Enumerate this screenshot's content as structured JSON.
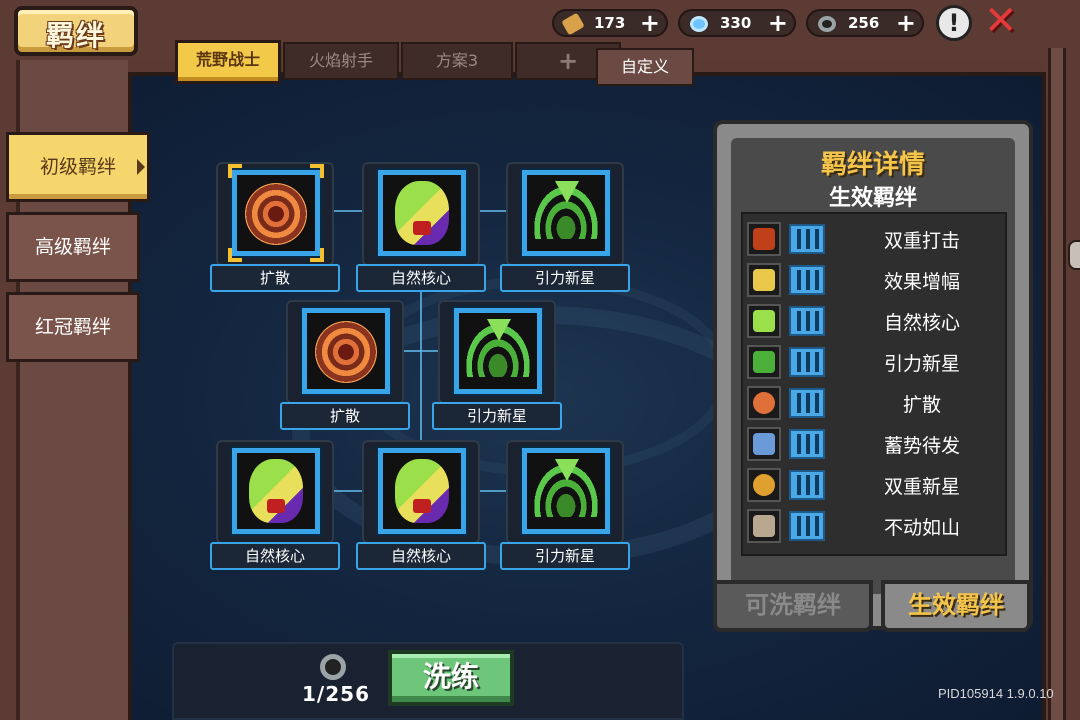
{
  "header": {
    "title": "羁绊",
    "currencies": [
      {
        "name": "gold",
        "amount": "173",
        "icon": "horn-icon"
      },
      {
        "name": "gem",
        "amount": "330",
        "icon": "gem-icon"
      },
      {
        "name": "stone",
        "amount": "256",
        "icon": "gear-stone-icon"
      }
    ],
    "plus": "+",
    "alert": "!",
    "close": "✕"
  },
  "plan_tabs": [
    {
      "label": "荒野战士",
      "active": true
    },
    {
      "label": "火焰射手",
      "active": false
    },
    {
      "label": "方案3",
      "active": false
    },
    {
      "label": "+",
      "active": false
    },
    {
      "label": "自定义",
      "active": false
    }
  ],
  "side_tabs": [
    {
      "label": "初级羁绊",
      "active": true
    },
    {
      "label": "高级羁绊",
      "active": false
    },
    {
      "label": "红冠羁绊",
      "active": false
    }
  ],
  "grid": [
    {
      "label": "扩散",
      "icon": "ring-icon",
      "selected": true
    },
    {
      "label": "自然核心",
      "icon": "nature-core-icon",
      "selected": false
    },
    {
      "label": "引力新星",
      "icon": "gravity-star-icon",
      "selected": false
    },
    {
      "label": "扩散",
      "icon": "ring-icon",
      "selected": false
    },
    {
      "label": "引力新星",
      "icon": "gravity-star-icon",
      "selected": false
    },
    {
      "label": "自然核心",
      "icon": "nature-core-icon",
      "selected": false
    },
    {
      "label": "自然核心",
      "icon": "nature-core-icon",
      "selected": false
    },
    {
      "label": "引力新星",
      "icon": "gravity-star-icon",
      "selected": false
    }
  ],
  "panel": {
    "title": "羁绊详情",
    "subtitle": "生效羁绊",
    "effects": [
      {
        "name": "双重打击",
        "color": "#c0401a"
      },
      {
        "name": "效果增幅",
        "color": "#e8c84a"
      },
      {
        "name": "自然核心",
        "color": "#9be04a"
      },
      {
        "name": "引力新星",
        "color": "#4ab03a"
      },
      {
        "name": "扩散",
        "color": "#e0703a"
      },
      {
        "name": "蓄势待发",
        "color": "#6a9ad8"
      },
      {
        "name": "双重新星",
        "color": "#e0a030"
      },
      {
        "name": "不动如山",
        "color": "#b8a890"
      }
    ],
    "tab_available": "可洗羁绊",
    "tab_active": "生效羁绊"
  },
  "bottom": {
    "count": "1/256",
    "refine_label": "洗练"
  },
  "version": "PID105914 1.9.0.10",
  "colors": {
    "accent": "#f3c94a",
    "slot_border": "#3aa4e8",
    "refine": "#6dc67a"
  }
}
